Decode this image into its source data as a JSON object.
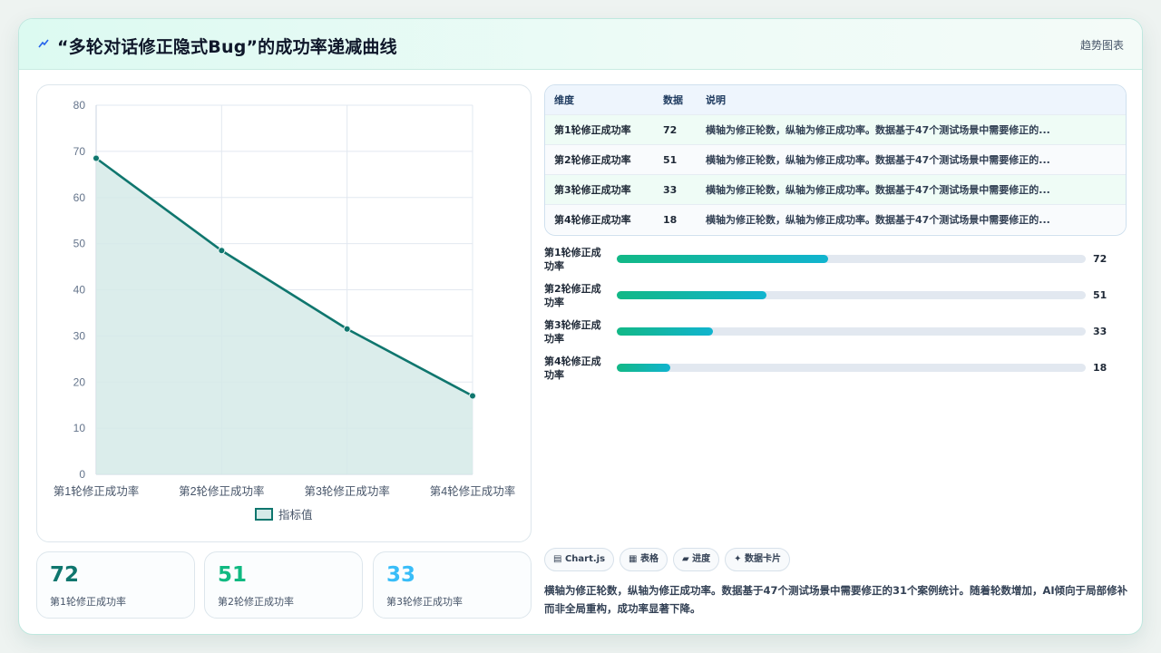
{
  "header": {
    "title": "“多轮对话修正隐式Bug”的成功率递减曲线",
    "tag": "趋势图表",
    "icon": "sparkle-icon"
  },
  "chart_data": {
    "type": "line",
    "categories": [
      "第1轮修正成功率",
      "第2轮修正成功率",
      "第3轮修正成功率",
      "第4轮修正成功率"
    ],
    "series": [
      {
        "name": "指标值",
        "values": [
          68.5,
          48.5,
          31.5,
          17
        ]
      }
    ],
    "ylim": [
      0,
      80
    ],
    "yticks": [
      0,
      10,
      20,
      30,
      40,
      50,
      60,
      70,
      80
    ],
    "grid": true,
    "legend": "bottom",
    "line_color": "#0f766e",
    "fill_color": "#d5eae8"
  },
  "table": {
    "headers": [
      "维度",
      "数据",
      "说明"
    ],
    "rows": [
      [
        "第1轮修正成功率",
        "72",
        "横轴为修正轮数，纵轴为修正成功率。数据基于47个测试场景中需要修正的..."
      ],
      [
        "第2轮修正成功率",
        "51",
        "横轴为修正轮数，纵轴为修正成功率。数据基于47个测试场景中需要修正的..."
      ],
      [
        "第3轮修正成功率",
        "33",
        "横轴为修正轮数，纵轴为修正成功率。数据基于47个测试场景中需要修正的..."
      ],
      [
        "第4轮修正成功率",
        "18",
        "横轴为修正轮数，纵轴为修正成功率。数据基于47个测试场景中需要修正的..."
      ]
    ]
  },
  "bars": [
    {
      "label": "第1轮修正成功率",
      "value": "72",
      "fraction": 0.45
    },
    {
      "label": "第2轮修正成功率",
      "value": "51",
      "fraction": 0.32
    },
    {
      "label": "第3轮修正成功率",
      "value": "33",
      "fraction": 0.205
    },
    {
      "label": "第4轮修正成功率",
      "value": "18",
      "fraction": 0.115
    }
  ],
  "kpis": [
    {
      "value": "72",
      "label": "第1轮修正成功率",
      "color": "#0f766e"
    },
    {
      "value": "51",
      "label": "第2轮修正成功率",
      "color": "#10b981"
    },
    {
      "value": "33",
      "label": "第3轮修正成功率",
      "color": "#38bdf8"
    }
  ],
  "chips": [
    "Chart.js",
    "表格",
    "进度",
    "数据卡片"
  ],
  "description": "横轴为修正轮数，纵轴为修正成功率。数据基于47个测试场景中需要修正的31个案例统计。随着轮数增加，AI倾向于局部修补而非全局重构，成功率显著下降。"
}
